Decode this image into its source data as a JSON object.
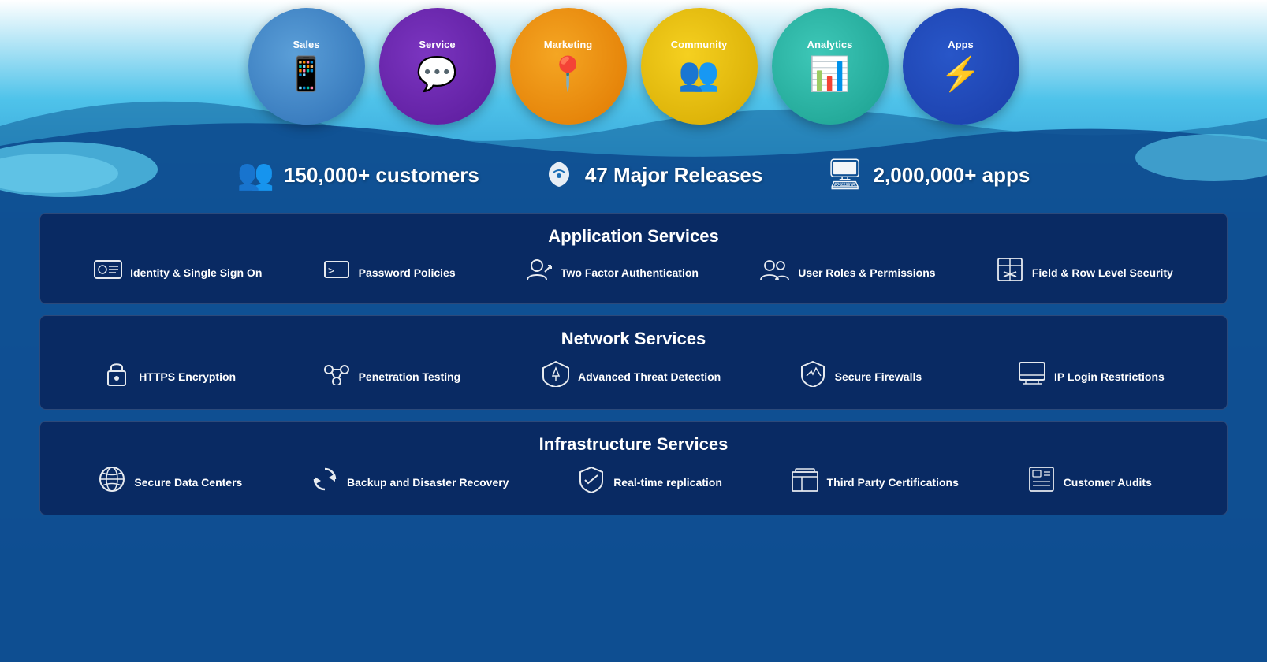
{
  "background": {
    "gradient_start": "#29b5e8",
    "gradient_end": "#0d4a8a"
  },
  "circles": [
    {
      "id": "sales",
      "label": "Sales",
      "icon": "📱",
      "class": "circle-sales"
    },
    {
      "id": "service",
      "label": "Service",
      "icon": "💬",
      "class": "circle-service"
    },
    {
      "id": "marketing",
      "label": "Marketing",
      "icon": "📍",
      "class": "circle-marketing"
    },
    {
      "id": "community",
      "label": "Community",
      "icon": "👥",
      "class": "circle-community"
    },
    {
      "id": "analytics",
      "label": "Analytics",
      "icon": "📊",
      "class": "circle-analytics"
    },
    {
      "id": "apps",
      "label": "Apps",
      "icon": "⚡",
      "class": "circle-apps"
    }
  ],
  "stats": [
    {
      "id": "customers",
      "icon": "👥",
      "text": "150,000+ customers"
    },
    {
      "id": "releases",
      "icon": "☁",
      "text": "47 Major Releases"
    },
    {
      "id": "apps",
      "icon": "🖥",
      "text": "2,000,000+ apps"
    }
  ],
  "sections": [
    {
      "id": "application",
      "title": "Application Services",
      "items": [
        {
          "id": "identity",
          "icon": "🪪",
          "name": "Identity & Single Sign On"
        },
        {
          "id": "password",
          "icon": "⌨",
          "name": "Password Policies"
        },
        {
          "id": "twofactor",
          "icon": "👤",
          "name": "Two Factor Authentication"
        },
        {
          "id": "userroles",
          "icon": "👥",
          "name": "User Roles & Permissions"
        },
        {
          "id": "fieldrow",
          "icon": "✂",
          "name": "Field & Row Level Security"
        }
      ]
    },
    {
      "id": "network",
      "title": "Network Services",
      "items": [
        {
          "id": "https",
          "icon": "🔒",
          "name": "HTTPS Encryption"
        },
        {
          "id": "penetration",
          "icon": "🔀",
          "name": "Penetration Testing"
        },
        {
          "id": "threat",
          "icon": "🛡",
          "name": "Advanced Threat Detection"
        },
        {
          "id": "firewalls",
          "icon": "🛡",
          "name": "Secure Firewalls"
        },
        {
          "id": "iplogin",
          "icon": "🖥",
          "name": "IP Login Restrictions"
        }
      ]
    },
    {
      "id": "infrastructure",
      "title": "Infrastructure Services",
      "items": [
        {
          "id": "datacenter",
          "icon": "🌐",
          "name": "Secure Data Centers"
        },
        {
          "id": "backup",
          "icon": "🔄",
          "name": "Backup and Disaster Recovery"
        },
        {
          "id": "replication",
          "icon": "🛡",
          "name": "Real-time replication"
        },
        {
          "id": "thirdparty",
          "icon": "🗄",
          "name": "Third Party Certifications"
        },
        {
          "id": "audits",
          "icon": "📊",
          "name": "Customer Audits"
        }
      ]
    }
  ]
}
